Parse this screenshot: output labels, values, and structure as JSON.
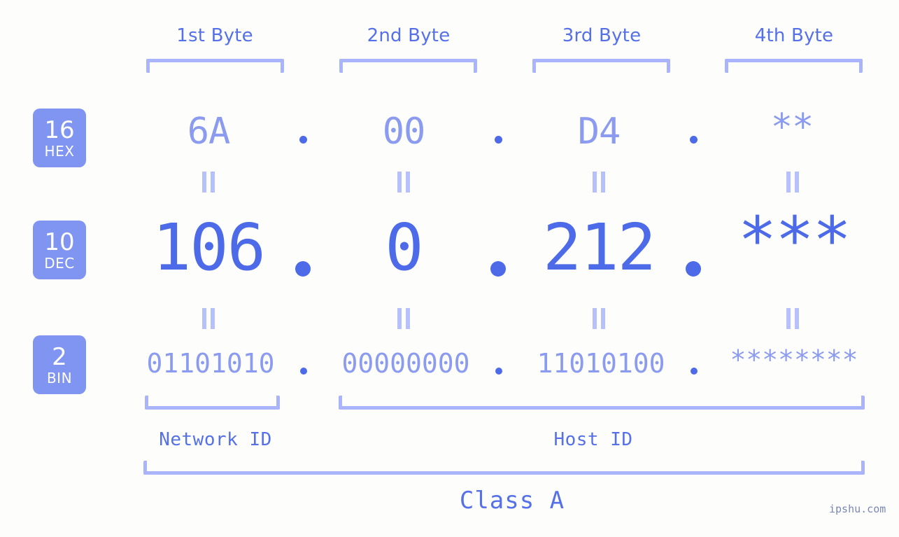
{
  "meta": {
    "credit": "ipshu.com",
    "accent_strong": "#4d6ae8",
    "accent_light": "#8b9bf0",
    "accent_bracket": "#aab4fb",
    "badge_bg": "#8094f2",
    "background": "#fdfefb"
  },
  "header": {
    "bytes": [
      {
        "label": "1st Byte"
      },
      {
        "label": "2nd Byte"
      },
      {
        "label": "3rd Byte"
      },
      {
        "label": "4th Byte"
      }
    ]
  },
  "rows": [
    {
      "badge_number": "16",
      "badge_name": "HEX",
      "values": [
        "6A",
        "00",
        "D4",
        "**"
      ],
      "separator": "."
    },
    {
      "badge_number": "10",
      "badge_name": "DEC",
      "values": [
        "106",
        "0",
        "212",
        "***"
      ],
      "separator": "."
    },
    {
      "badge_number": "2",
      "badge_name": "BIN",
      "values": [
        "01101010",
        "00000000",
        "11010100",
        "********"
      ],
      "separator": "."
    }
  ],
  "equality_symbol": "=",
  "segments": {
    "network_id": "Network ID",
    "host_id": "Host ID",
    "class": "Class A"
  }
}
